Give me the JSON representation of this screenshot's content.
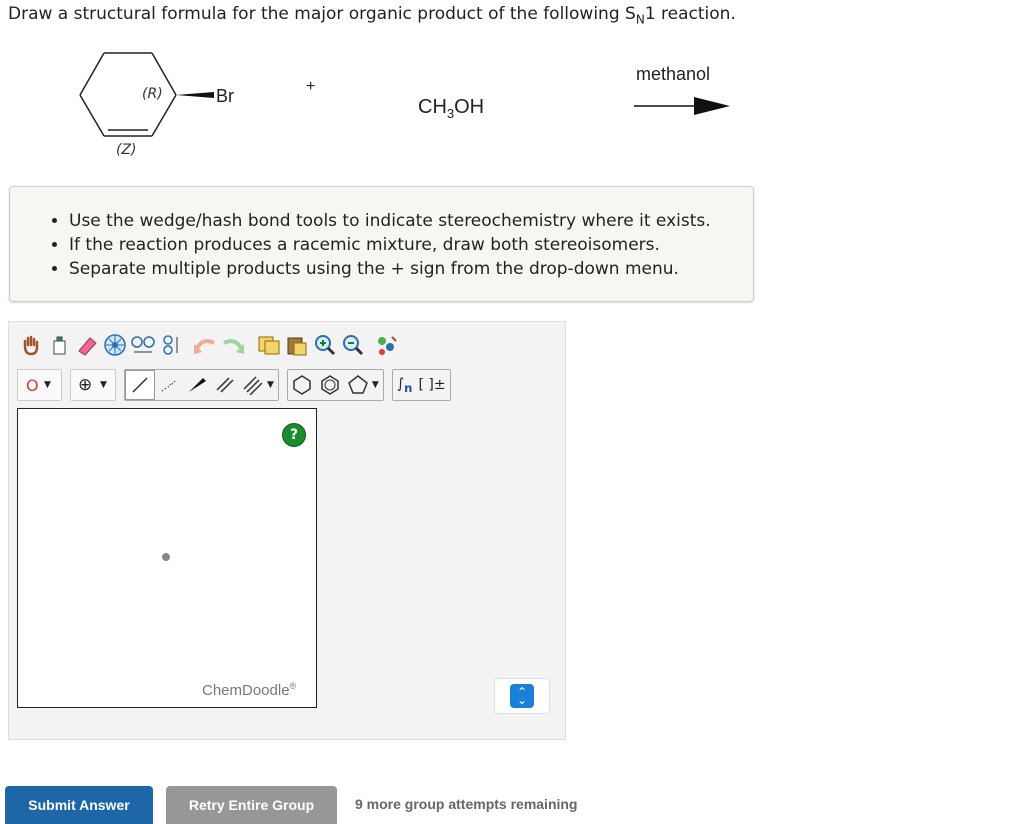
{
  "question": {
    "prefix": "Draw a structural formula for the major organic product of the following S",
    "sub": "N",
    "suffix": "1 reaction."
  },
  "reaction": {
    "stereo_r": "(R)",
    "stereo_z": "(Z)",
    "leaving_group": "Br",
    "plus": "+",
    "reagent_main": "CH",
    "reagent_sub": "3",
    "reagent_tail": "OH",
    "arrow_label": "methanol"
  },
  "instructions": [
    "Use the wedge/hash bond tools to indicate stereochemistry where it exists.",
    "If the reaction produces a racemic mixture, draw both stereoisomers.",
    "Separate multiple products using the + sign from the drop-down menu."
  ],
  "toolbar": {
    "atom_value": "O",
    "charge_symbol": "⊕",
    "brackets": "[ ]±",
    "sgroup": "n"
  },
  "sketcher": {
    "help": "?",
    "brand": "ChemDoodle",
    "reg": "®"
  },
  "buttons": {
    "submit": "Submit Answer",
    "retry": "Retry Entire Group"
  },
  "attempts": "9 more group attempts remaining",
  "colors": {
    "primary": "#1d67a8",
    "retry": "#979797",
    "help": "#1a8c2e"
  }
}
